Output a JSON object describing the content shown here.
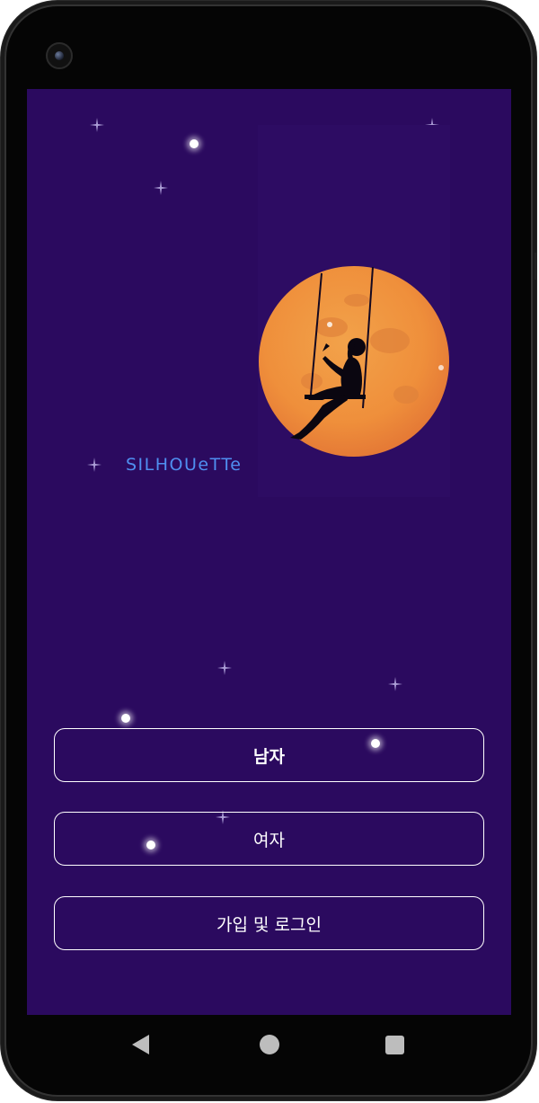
{
  "app": {
    "brand_text": "SILHOUeTTe"
  },
  "illustration": {
    "moon_color": "#f0913a",
    "subject": "girl-on-swing-silhouette"
  },
  "buttons": {
    "male_label": "남자",
    "female_label": "여자",
    "signup_login_label": "가입 및 로그인"
  },
  "colors": {
    "background": "#2b0a5f",
    "brand": "#4f8ff0",
    "button_border": "#ffffff"
  },
  "icons": {
    "nav_back": "back-triangle-icon",
    "nav_home": "home-circle-icon",
    "nav_recent": "recent-square-icon"
  }
}
